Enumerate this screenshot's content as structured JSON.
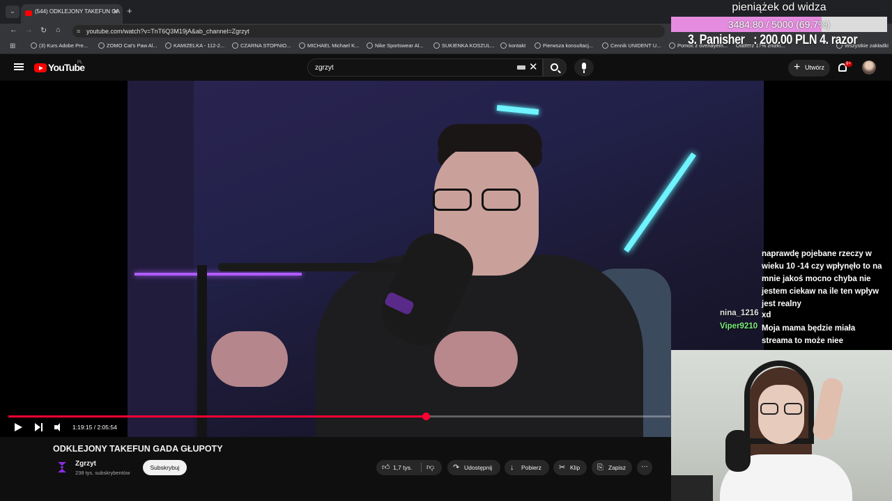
{
  "browser": {
    "tab_title": "(544) ODKLEJONY TAKEFUN GA",
    "url": "youtube.com/watch?v=TnT6Q3M19jA&ab_channel=Zgrzyt",
    "bookmarks": [
      "(3) Kurs Adobe Pre...",
      "ZOMO Cat's Paw Al...",
      "KAMIZELKA - 112-2...",
      "CZARNA STOPNIO...",
      "MICHAEL Michael K...",
      "Nike Sportswear Al...",
      "SUKIENKA KOSZUL...",
      "kontakt",
      "Pierwsza konsultacj...",
      "Cennik UNIDENT U...",
      "Pomoc z ovenayem...",
      "Odbierz 17% zniżki...",
      "Wszystkie zakładki"
    ]
  },
  "donation": {
    "title": "pieniążek od widza",
    "progress_text": "3484.80 / 5000 (69.7%)",
    "progress_fraction": 0.697,
    "ranking": "3. Panisher_ : 200.00 PLN   4. razor"
  },
  "youtube": {
    "logo_text": "YouTube",
    "country": "PL",
    "search_value": "zgrzyt",
    "create_label": "Utwórz",
    "notifications_badge": "9+"
  },
  "player": {
    "time": "1:19:15 / 2:05:54",
    "progress_fraction": 0.63
  },
  "video": {
    "title": "ODKLEJONY TAKEFUN GADA GŁUPOTY",
    "channel": "Zgrzyt",
    "subscribers": "238 tys. subskrybentów",
    "subscribe_label": "Subskrybuj",
    "likes": "1,7 tys.",
    "share_label": "Udostępnij",
    "download_label": "Pobierz",
    "clip_label": "Klip",
    "save_label": "Zapisz",
    "more_label": "···"
  },
  "chat": {
    "message1": "naprawdę pojebane rzeczy w wieku 10 -14 czy wpłynęło to na mnie jakoś mocno chyba nie jestem ciekaw na ile ten wpływ jest realny",
    "user2": "nina_1216",
    "message2": "xd",
    "user3": "Viper9210",
    "message3": "Moja mama będzie miała streama to może niee"
  },
  "colors": {
    "youtube_red": "#ff0000",
    "progress_red": "#ff0033",
    "donation_pink": "#d86bd0",
    "viper_green": "#7bf07b"
  }
}
